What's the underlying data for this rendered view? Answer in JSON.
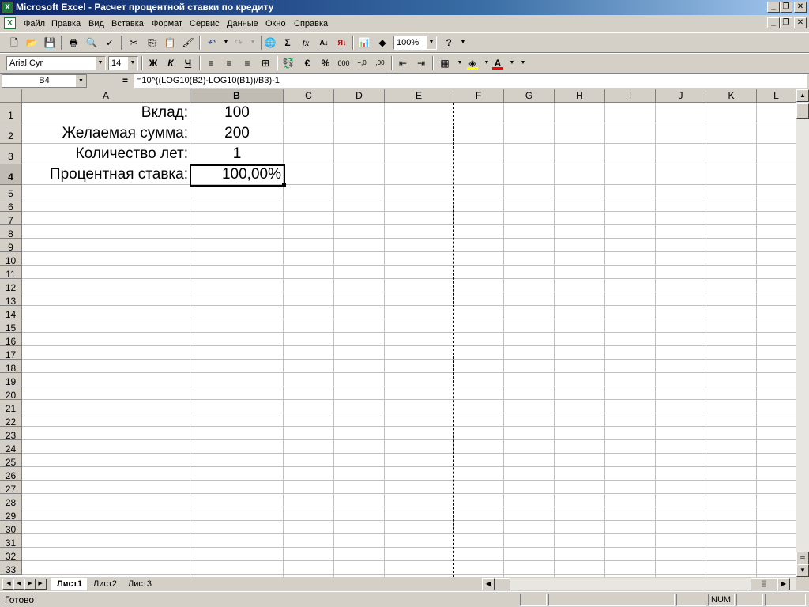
{
  "window": {
    "title": "Microsoft Excel - Расчет процентной ставки по кредиту",
    "app_icon": "excel-icon"
  },
  "menu": {
    "items": [
      "Файл",
      "Правка",
      "Вид",
      "Вставка",
      "Формат",
      "Сервис",
      "Данные",
      "Окно",
      "Справка"
    ]
  },
  "standard_toolbar": {
    "zoom": "100%",
    "icons": [
      "new-icon",
      "open-icon",
      "save-icon",
      "print-icon",
      "print-preview-icon",
      "spelling-icon",
      "cut-icon",
      "copy-icon",
      "paste-icon",
      "format-painter-icon",
      "undo-icon",
      "redo-icon",
      "hyperlink-icon",
      "autosum-icon",
      "function-icon",
      "sort-ascending-icon",
      "sort-descending-icon",
      "chart-wizard-icon",
      "drawing-icon",
      "help-icon"
    ]
  },
  "formatting_toolbar": {
    "font": "Arial Cyr",
    "size": "14",
    "bold_label": "Ж",
    "italic_label": "К",
    "underline_label": "Ч",
    "percent_label": "%",
    "thousands_label": "000",
    "euro_label": "€",
    "font_color": "#ff0000",
    "fill_color": "#ffff00"
  },
  "formula_bar": {
    "name_box": "B4",
    "equals": "=",
    "formula": "=10^((LOG10(B2)-LOG10(B1))/B3)-1"
  },
  "columns": [
    "A",
    "B",
    "C",
    "D",
    "E",
    "F",
    "G",
    "H",
    "I",
    "J",
    "K",
    "L"
  ],
  "rows": [
    "1",
    "2",
    "3",
    "4",
    "5",
    "6",
    "7",
    "8",
    "9",
    "10",
    "11",
    "12",
    "13",
    "14",
    "15",
    "16",
    "17",
    "18",
    "19",
    "20",
    "21",
    "22",
    "23",
    "24",
    "25",
    "26",
    "27",
    "28",
    "29",
    "30",
    "31",
    "32",
    "33"
  ],
  "selected": {
    "column": "B",
    "row": "4"
  },
  "cells": {
    "a1": "Вклад:",
    "b1": "100",
    "a2": "Желаемая сумма:",
    "b2": "200",
    "a3": "Количество лет:",
    "b3": "1",
    "a4": "Процентная ставка:",
    "b4": "100,00%"
  },
  "sheets": {
    "tabs": [
      "Лист1",
      "Лист2",
      "Лист3"
    ],
    "active": "Лист1"
  },
  "status": {
    "text": "Готово",
    "num": "NUM"
  }
}
